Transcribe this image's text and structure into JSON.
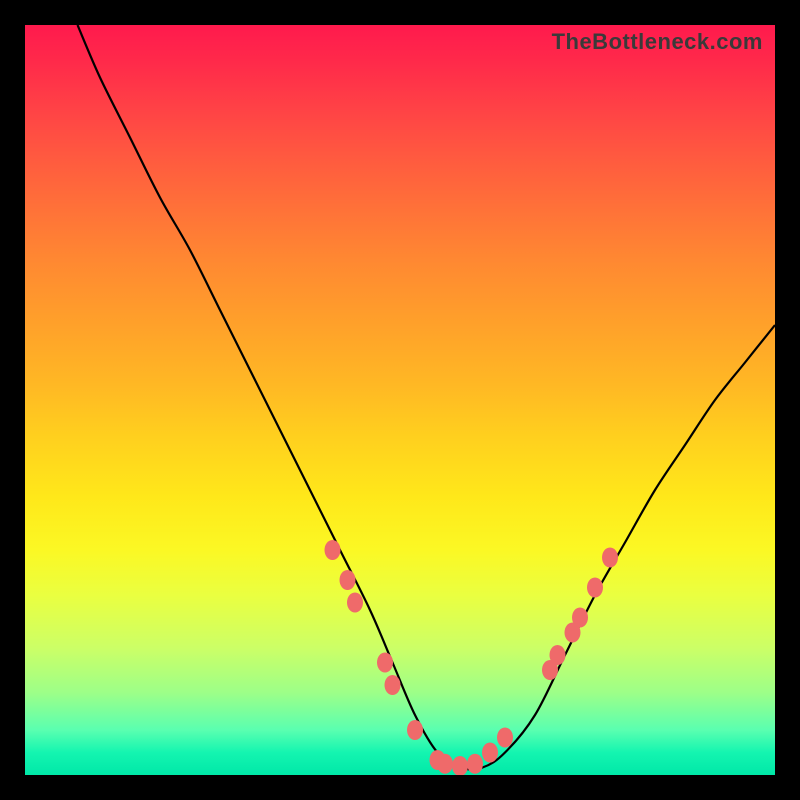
{
  "watermark": "TheBottleneck.com",
  "colors": {
    "curve": "#000000",
    "dot": "#ef6a6a",
    "frame_bg": "#000000"
  },
  "chart_data": {
    "type": "line",
    "title": "",
    "xlabel": "",
    "ylabel": "",
    "xlim": [
      0,
      100
    ],
    "ylim": [
      0,
      100
    ],
    "legend": false,
    "grid": false,
    "series": [
      {
        "name": "bottleneck-curve",
        "note": "V-shaped curve; left branch steep descent from top-left to minimum near x≈55, then right branch ascent to upper-right. y=0 near x=50-60, y≈100 at x≈7 and y≈60 at x=100.",
        "x": [
          7,
          10,
          14,
          18,
          22,
          26,
          30,
          34,
          38,
          42,
          46,
          49,
          52,
          55,
          58,
          61,
          64,
          68,
          72,
          76,
          80,
          84,
          88,
          92,
          96,
          100
        ],
        "values": [
          100,
          93,
          85,
          77,
          70,
          62,
          54,
          46,
          38,
          30,
          22,
          15,
          8,
          3,
          1,
          1,
          3,
          8,
          16,
          24,
          31,
          38,
          44,
          50,
          55,
          60
        ]
      }
    ],
    "markers": {
      "name": "highlight-dots",
      "note": "Salmon dots clustered along the curve near and around the minimum and partway up the right branch.",
      "points": [
        {
          "x": 41,
          "y": 30
        },
        {
          "x": 43,
          "y": 26
        },
        {
          "x": 44,
          "y": 23
        },
        {
          "x": 48,
          "y": 15
        },
        {
          "x": 49,
          "y": 12
        },
        {
          "x": 52,
          "y": 6
        },
        {
          "x": 55,
          "y": 2
        },
        {
          "x": 56,
          "y": 1.5
        },
        {
          "x": 58,
          "y": 1.2
        },
        {
          "x": 60,
          "y": 1.5
        },
        {
          "x": 62,
          "y": 3
        },
        {
          "x": 64,
          "y": 5
        },
        {
          "x": 70,
          "y": 14
        },
        {
          "x": 71,
          "y": 16
        },
        {
          "x": 73,
          "y": 19
        },
        {
          "x": 74,
          "y": 21
        },
        {
          "x": 76,
          "y": 25
        },
        {
          "x": 78,
          "y": 29
        }
      ]
    }
  }
}
